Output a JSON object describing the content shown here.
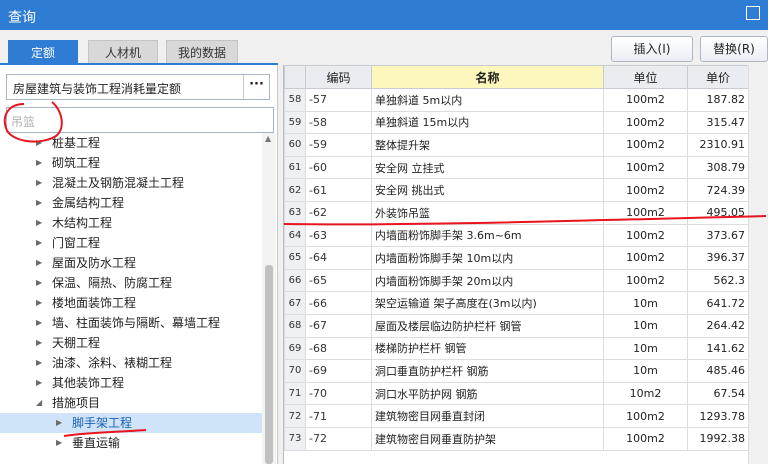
{
  "window": {
    "title": "查询",
    "close_glyph": "▢"
  },
  "tabs": [
    {
      "label": "定额",
      "active": true
    },
    {
      "label": "人材机",
      "active": false
    },
    {
      "label": "我的数据",
      "active": false
    }
  ],
  "toolbar": {
    "insert_label": "插入(I)",
    "replace_label": "替换(R)"
  },
  "library_select": {
    "value": "房屋建筑与装饰工程消耗量定额",
    "more_label": "···"
  },
  "search": {
    "placeholder": "吊篮"
  },
  "tree": [
    {
      "label": "桩基工程",
      "expanded": false,
      "level": 1
    },
    {
      "label": "砌筑工程",
      "expanded": false,
      "level": 1
    },
    {
      "label": "混凝土及钢筋混凝土工程",
      "expanded": false,
      "level": 1
    },
    {
      "label": "金属结构工程",
      "expanded": false,
      "level": 1
    },
    {
      "label": "木结构工程",
      "expanded": false,
      "level": 1
    },
    {
      "label": "门窗工程",
      "expanded": false,
      "level": 1
    },
    {
      "label": "屋面及防水工程",
      "expanded": false,
      "level": 1
    },
    {
      "label": "保温、隔热、防腐工程",
      "expanded": false,
      "level": 1
    },
    {
      "label": "楼地面装饰工程",
      "expanded": false,
      "level": 1
    },
    {
      "label": "墙、柱面装饰与隔断、幕墙工程",
      "expanded": false,
      "level": 1
    },
    {
      "label": "天棚工程",
      "expanded": false,
      "level": 1
    },
    {
      "label": "油漆、涂料、裱糊工程",
      "expanded": false,
      "level": 1
    },
    {
      "label": "其他装饰工程",
      "expanded": false,
      "level": 1
    },
    {
      "label": "措施项目",
      "expanded": true,
      "level": 1
    },
    {
      "label": "脚手架工程",
      "expanded": false,
      "level": 2,
      "selected": true
    },
    {
      "label": "垂直运输",
      "expanded": false,
      "level": 2
    }
  ],
  "table": {
    "columns": [
      "",
      "编码",
      "名称",
      "单位",
      "单价"
    ],
    "rows": [
      {
        "n": "58",
        "code": "-57",
        "name": "单独斜道 5m以内",
        "unit": "100m2",
        "price": "187.82"
      },
      {
        "n": "59",
        "code": "-58",
        "name": "单独斜道 15m以内",
        "unit": "100m2",
        "price": "315.47"
      },
      {
        "n": "60",
        "code": "-59",
        "name": "整体提升架",
        "unit": "100m2",
        "price": "2310.91"
      },
      {
        "n": "61",
        "code": "-60",
        "name": "安全网 立挂式",
        "unit": "100m2",
        "price": "308.79"
      },
      {
        "n": "62",
        "code": "-61",
        "name": "安全网 挑出式",
        "unit": "100m2",
        "price": "724.39"
      },
      {
        "n": "63",
        "code": "-62",
        "name": "外装饰吊篮",
        "unit": "100m2",
        "price": "495.05"
      },
      {
        "n": "64",
        "code": "-63",
        "name": "内墙面粉饰脚手架 3.6m~6m",
        "unit": "100m2",
        "price": "373.67"
      },
      {
        "n": "65",
        "code": "-64",
        "name": "内墙面粉饰脚手架 10m以内",
        "unit": "100m2",
        "price": "396.37"
      },
      {
        "n": "66",
        "code": "-65",
        "name": "内墙面粉饰脚手架 20m以内",
        "unit": "100m2",
        "price": "562.3"
      },
      {
        "n": "67",
        "code": "-66",
        "name": "架空运输道 架子高度在(3m以内)",
        "unit": "10m",
        "price": "641.72"
      },
      {
        "n": "68",
        "code": "-67",
        "name": "屋面及楼层临边防护栏杆 钢管",
        "unit": "10m",
        "price": "264.42"
      },
      {
        "n": "69",
        "code": "-68",
        "name": "楼梯防护栏杆 钢管",
        "unit": "10m",
        "price": "141.62"
      },
      {
        "n": "70",
        "code": "-69",
        "name": "洞口垂直防护栏杆 钢筋",
        "unit": "10m",
        "price": "485.46"
      },
      {
        "n": "71",
        "code": "-70",
        "name": "洞口水平防护网 钢筋",
        "unit": "10m2",
        "price": "67.54"
      },
      {
        "n": "72",
        "code": "-71",
        "name": "建筑物密目网垂直封闭",
        "unit": "100m2",
        "price": "1293.78"
      },
      {
        "n": "73",
        "code": "-72",
        "name": "建筑物密目网垂直防护架",
        "unit": "100m2",
        "price": "1992.38"
      }
    ]
  },
  "colors": {
    "accent": "#2e7cd4",
    "annotation": "#e8141e",
    "name_header": "#fdf7bd"
  }
}
